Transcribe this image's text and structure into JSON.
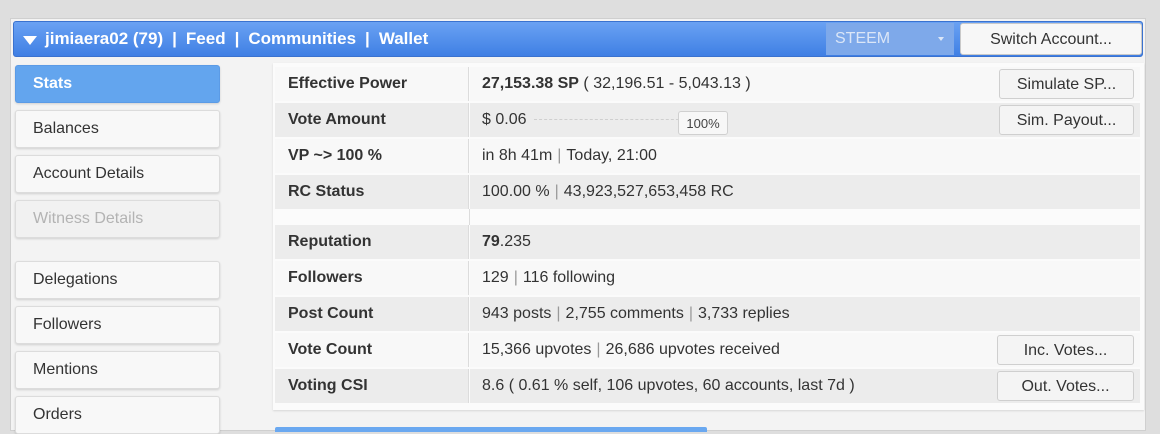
{
  "header": {
    "username": "jimiaera02 (79)",
    "nav": [
      "Feed",
      "Communities",
      "Wallet"
    ],
    "separator": "|",
    "chain": "STEEM",
    "switch_label": "Switch Account..."
  },
  "sidebar": {
    "items": [
      {
        "label": "Stats"
      },
      {
        "label": "Balances"
      },
      {
        "label": "Account Details"
      },
      {
        "label": "Witness Details"
      },
      {
        "label": "Delegations"
      },
      {
        "label": "Followers"
      },
      {
        "label": "Mentions"
      },
      {
        "label": "Orders"
      }
    ]
  },
  "stats": {
    "effective_power": {
      "label": "Effective Power",
      "sp": "27,153.38 SP",
      "detail": "( 32,196.51 - 5,043.13 )",
      "button": "Simulate SP..."
    },
    "vote_amount": {
      "label": "Vote Amount",
      "value": "$ 0.06",
      "slider_pct": 100,
      "slider_label": "100%",
      "button": "Sim. Payout..."
    },
    "vp": {
      "label": "VP ~> 100 %",
      "time": "in 8h 41m",
      "at": "Today, 21:00"
    },
    "rc": {
      "label": "RC Status",
      "pct": "100.00 %",
      "amount": "43,923,527,653,458 RC"
    },
    "reputation": {
      "label": "Reputation",
      "int": "79",
      "dec": ".235"
    },
    "followers": {
      "label": "Followers",
      "count": "129",
      "following": "116 following"
    },
    "post_count": {
      "label": "Post Count",
      "posts": "943 posts",
      "comments": "2,755 comments",
      "replies": "3,733 replies"
    },
    "vote_count": {
      "label": "Vote Count",
      "upvotes": "15,366 upvotes",
      "received": "26,686 upvotes received",
      "button": "Inc. Votes..."
    },
    "voting_csi": {
      "label": "Voting CSI",
      "value": "8.6 ( 0.61 % self, 106 upvotes, 60 accounts, last 7d )",
      "button": "Out. Votes..."
    }
  },
  "colors": {
    "header": "#4a89ea",
    "active_item": "#63a5ee"
  }
}
